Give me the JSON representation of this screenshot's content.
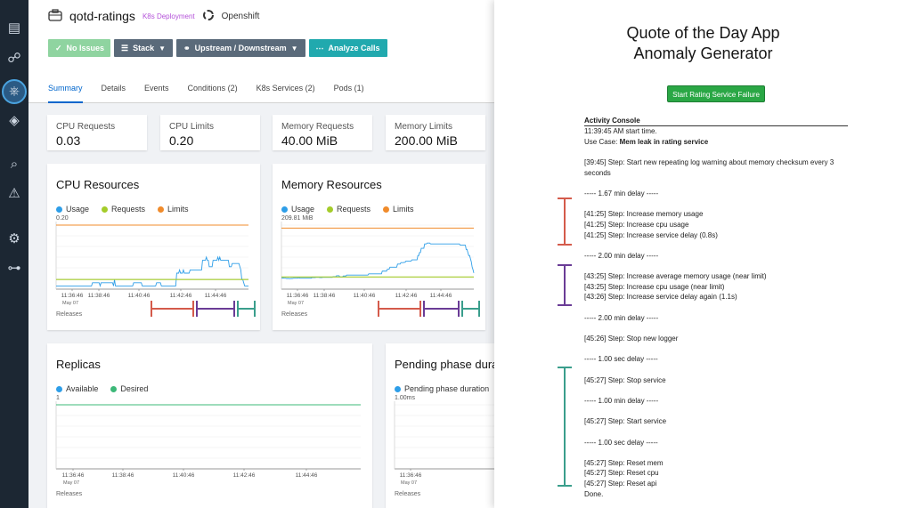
{
  "nav": {
    "icons": [
      "overview-icon",
      "graph-icon",
      "applications-icon",
      "services-icon",
      "distributed-tracing-icon",
      "alerts-icon",
      "settings-icon",
      "mesh-icon"
    ]
  },
  "header": {
    "app_icon": "briefcase-icon",
    "title": "qotd-ratings",
    "badge": "K8s Deployment",
    "platform": "Openshift"
  },
  "buttons": {
    "no_issues": "No Issues",
    "stack": "Stack",
    "upstream": "Upstream / Downstream",
    "analyze": "Analyze Calls"
  },
  "tabs": [
    "Summary",
    "Details",
    "Events",
    "Conditions (2)",
    "K8s Services (2)",
    "Pods (1)"
  ],
  "metrics": [
    {
      "label": "CPU Requests",
      "value": "0.03"
    },
    {
      "label": "CPU Limits",
      "value": "0.20"
    },
    {
      "label": "Memory Requests",
      "value": "40.00 MiB"
    },
    {
      "label": "Memory Limits",
      "value": "200.00 MiB"
    }
  ],
  "colors": {
    "usage": "#2e9ee8",
    "requests": "#a4cc2a",
    "limits": "#f08b2b",
    "desired": "#3cb878",
    "red_marker": "#d45b4b",
    "purple_marker": "#6a3c96",
    "teal_marker": "#3a9e8c",
    "nav_bg": "#1c2733",
    "primary": "#0066cc"
  },
  "cpu_chart": {
    "title": "CPU Resources",
    "legend": [
      "Usage",
      "Requests",
      "Limits"
    ],
    "ymax_label": "0.20",
    "x_ticks": [
      "11:36:46",
      "11:38:46",
      "11:40:46",
      "11:42:46",
      "11:44:46"
    ],
    "date_label": "May 07",
    "releases": "Releases"
  },
  "memory_chart": {
    "title": "Memory Resources",
    "legend": [
      "Usage",
      "Requests",
      "Limits"
    ],
    "ymax_label": "209.81 MiB",
    "x_ticks": [
      "11:36:46",
      "11:38:46",
      "11:40:46",
      "11:42:46",
      "11:44:46"
    ],
    "date_label": "May 07",
    "releases": "Releases"
  },
  "replicas_chart": {
    "title": "Replicas",
    "legend": [
      "Available",
      "Desired"
    ],
    "ymax_label": "1",
    "x_ticks": [
      "11:36:46",
      "11:38:46",
      "11:40:46",
      "11:42:46",
      "11:44:46"
    ],
    "date_label": "May 07",
    "releases": "Releases"
  },
  "pending_chart": {
    "title": "Pending phase duration",
    "legend": [
      "Pending phase duration"
    ],
    "ymax_label": "1.00ms",
    "x_ticks": [
      "11:36:46"
    ],
    "date_label": "May 07",
    "releases": "Releases"
  },
  "chart_data": [
    {
      "type": "line",
      "title": "CPU Resources",
      "ylim": [
        0,
        0.2
      ],
      "x_ticks": [
        "11:36:46",
        "11:38:46",
        "11:40:46",
        "11:42:46",
        "11:44:46"
      ],
      "series": [
        {
          "name": "Usage",
          "values": [
            0.01,
            0.01,
            0.01,
            0.01,
            0.01,
            0.01,
            0.01,
            0.01,
            0.01,
            0.01,
            0.01,
            0.01,
            0.01,
            0.01,
            0.01,
            0.01,
            0.01,
            0.01,
            0.01,
            0.01,
            0.01,
            0.01,
            0.01,
            0.01,
            0.01,
            0.01,
            0.01,
            0.01,
            0.01,
            0.01,
            0.01,
            0.01,
            0.01,
            0.01,
            0.01,
            0.01,
            0.01,
            0.01,
            0.02,
            0.02,
            0.02,
            0.02,
            0.02,
            0.02,
            0.02,
            0.02,
            0.01,
            0.02,
            0.02,
            0.02,
            0.02,
            0.02,
            0.02,
            0.02,
            0.02,
            0.02,
            0.02,
            0.02,
            0.02,
            0.02,
            0.01,
            0.03,
            0.01,
            0.01,
            0.01,
            0.01,
            0.01,
            0.01,
            0.01,
            0.01,
            0.01,
            0.01,
            0.01,
            0.01,
            0.01,
            0.01,
            0.01,
            0.01,
            0.01,
            0.01,
            0.01,
            0.02,
            0.02,
            0.02,
            0.02,
            0.02,
            0.02,
            0.02,
            0.02,
            0.02,
            0.01,
            0.01,
            0.01,
            0.01,
            0.01,
            0.01,
            0.01,
            0.01,
            0.01,
            0.01,
            0.01,
            0.01,
            0.01,
            0.01,
            0.01,
            0.02,
            0.02,
            0.02,
            0.02,
            0.02,
            0.01,
            0.01,
            0.01,
            0.01,
            0.01,
            0.01,
            0.01,
            0.01,
            0.01,
            0.01,
            0.01,
            0.01,
            0.01,
            0.01,
            0.01,
            0.01,
            0.05,
            0.05,
            0.05,
            0.06,
            0.05,
            0.05,
            0.05,
            0.06,
            0.05,
            0.05,
            0.05,
            0.05,
            0.05,
            0.05,
            0.06,
            0.06,
            0.06,
            0.06,
            0.06,
            0.06,
            0.06,
            0.06,
            0.06,
            0.06,
            0.06,
            0.06,
            0.06,
            0.09,
            0.09,
            0.09,
            0.09,
            0.1,
            0.09,
            0.09,
            0.07,
            0.07,
            0.07,
            0.07,
            0.09,
            0.09,
            0.09,
            0.09,
            0.09,
            0.1,
            0.09,
            0.1,
            0.09,
            0.09,
            0.09,
            0.09,
            0.09,
            0.09,
            0.09,
            0.09,
            0.09,
            0.07,
            0.07,
            0.07,
            0.08,
            0.08,
            0.08,
            0.08,
            0.08,
            0.08,
            0.08,
            0.08,
            0.07,
            0.06,
            0.03,
            0.03,
            0.02,
            0.01,
            0.01,
            0.01,
            0.01,
            0.01
          ]
        },
        {
          "name": "Requests",
          "values": [
            0.03,
            0.03
          ]
        },
        {
          "name": "Limits",
          "values": [
            0.2,
            0.2
          ]
        }
      ]
    },
    {
      "type": "line",
      "title": "Memory Resources",
      "ylim": [
        0,
        209.81
      ],
      "x_ticks": [
        "11:36:46",
        "11:38:46",
        "11:40:46",
        "11:42:46",
        "11:44:46"
      ],
      "series": [
        {
          "name": "Usage",
          "values": [
            36,
            36,
            37,
            36,
            36,
            36,
            35,
            35,
            35,
            35,
            34,
            35,
            35,
            35,
            36,
            36,
            36,
            36,
            36,
            36,
            37,
            37,
            36,
            36,
            36,
            36,
            36,
            36,
            36,
            36,
            36,
            36,
            36,
            36,
            36,
            36,
            38,
            38,
            38,
            38,
            38,
            39,
            39,
            39,
            39,
            38,
            38,
            38,
            38,
            39,
            39,
            39,
            39,
            39,
            39,
            39,
            39,
            39,
            39,
            39,
            39,
            41,
            41,
            41,
            41,
            44,
            44,
            44,
            44,
            40,
            40,
            40,
            40,
            43,
            43,
            43,
            43,
            46,
            46,
            46,
            46,
            46,
            46,
            46,
            46,
            46,
            46,
            46,
            46,
            46,
            46,
            46,
            46,
            46,
            46,
            46,
            46,
            46,
            46,
            46,
            46,
            46,
            46,
            50,
            50,
            50,
            50,
            50,
            50,
            50,
            50,
            50,
            50,
            50,
            50,
            50,
            50,
            50,
            50,
            59,
            59,
            59,
            59,
            59,
            59,
            65,
            65,
            65,
            72,
            72,
            72,
            72,
            72,
            72,
            72,
            72,
            72,
            82,
            82,
            82,
            82,
            87,
            87,
            87,
            87,
            88,
            88,
            92,
            92,
            92,
            92,
            92,
            92,
            92,
            96,
            96,
            96,
            96,
            96,
            96,
            96,
            110,
            110,
            120,
            120,
            134,
            134,
            134,
            134,
            148,
            148,
            148,
            151,
            151,
            151,
            151,
            148,
            148,
            148,
            148,
            148,
            148,
            148,
            148,
            148,
            148,
            148,
            148,
            148,
            148,
            148,
            148,
            148,
            148,
            148,
            148,
            148,
            148,
            148,
            148,
            148,
            148,
            148,
            148,
            148,
            148,
            148,
            148,
            148,
            148,
            148,
            144,
            144,
            144,
            144,
            144,
            144,
            144,
            130,
            130,
            120,
            110,
            110,
            100,
            90,
            73,
            64,
            53
          ]
        },
        {
          "name": "Requests",
          "values": [
            40,
            40
          ]
        },
        {
          "name": "Limits",
          "values": [
            200,
            200
          ]
        }
      ]
    },
    {
      "type": "line",
      "title": "Replicas",
      "ylim": [
        0,
        1
      ],
      "x_ticks": [
        "11:36:46",
        "11:38:46",
        "11:40:46",
        "11:42:46",
        "11:44:46"
      ],
      "series": [
        {
          "name": "Desired",
          "values": [
            1,
            1
          ]
        }
      ]
    },
    {
      "type": "line",
      "title": "Pending phase duration",
      "ylim": [
        0,
        1
      ],
      "x_ticks": [
        "11:36:46"
      ],
      "series": [
        {
          "name": "Pending phase duration",
          "values": []
        }
      ]
    }
  ],
  "right": {
    "title_line1": "Quote of the Day App",
    "title_line2": "Anomaly Generator",
    "failure_button": "Start Rating Service Failure",
    "console_title": "Activity Console",
    "console_lines": [
      {
        "text": "11:39:45 AM start time.",
        "bold": false
      },
      {
        "prefix": "Use Case: ",
        "text": "Mem leak in rating service",
        "bold": true
      },
      {
        "text": "",
        "bold": false
      },
      {
        "text": "[39:45] Step: Start new repeating log warning about memory checksum every 3",
        "bold": false
      },
      {
        "text": "seconds",
        "bold": false
      },
      {
        "text": "",
        "bold": false
      },
      {
        "text": "----- 1.67 min delay -----",
        "bold": false
      },
      {
        "text": "",
        "bold": false
      },
      {
        "text": "[41:25] Step: Increase memory usage",
        "bold": false
      },
      {
        "text": "[41:25] Step: Increase cpu usage",
        "bold": false
      },
      {
        "text": "[41:25] Step: Increase service delay (0.8s)",
        "bold": false
      },
      {
        "text": "",
        "bold": false
      },
      {
        "text": "----- 2.00 min delay -----",
        "bold": false
      },
      {
        "text": "",
        "bold": false
      },
      {
        "text": "[43:25] Step: Increase average memory usage (near limit)",
        "bold": false
      },
      {
        "text": "[43:25] Step: Increase cpu usage (near limit)",
        "bold": false
      },
      {
        "text": "[43:26] Step: Increase service delay again (1.1s)",
        "bold": false
      },
      {
        "text": "",
        "bold": false
      },
      {
        "text": "----- 2.00 min delay -----",
        "bold": false
      },
      {
        "text": "",
        "bold": false
      },
      {
        "text": "[45:26] Step: Stop new logger",
        "bold": false
      },
      {
        "text": "",
        "bold": false
      },
      {
        "text": "----- 1.00 sec delay -----",
        "bold": false
      },
      {
        "text": "",
        "bold": false
      },
      {
        "text": "[45:27] Step: Stop service",
        "bold": false
      },
      {
        "text": "",
        "bold": false
      },
      {
        "text": "----- 1.00 min delay -----",
        "bold": false
      },
      {
        "text": "",
        "bold": false
      },
      {
        "text": "[45:27] Step: Start service",
        "bold": false
      },
      {
        "text": "",
        "bold": false
      },
      {
        "text": "----- 1.00 sec delay -----",
        "bold": false
      },
      {
        "text": "",
        "bold": false
      },
      {
        "text": "[45:27] Step: Reset mem",
        "bold": false
      },
      {
        "text": "[45:27] Step: Reset cpu",
        "bold": false
      },
      {
        "text": "[45:27] Step: Reset api",
        "bold": false
      },
      {
        "text": "Done.",
        "bold": false
      }
    ]
  }
}
